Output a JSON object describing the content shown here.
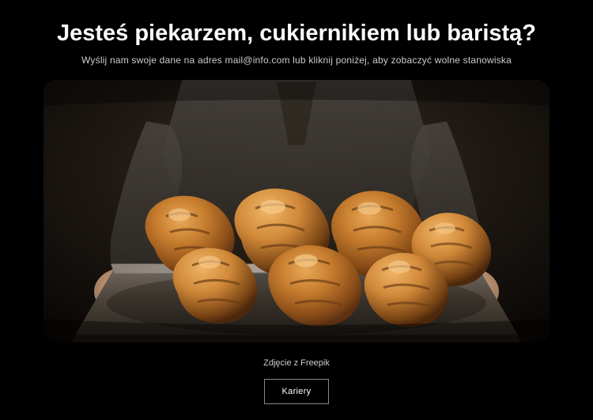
{
  "heading": "Jesteś piekarzem, cukiernikiem lub baristą?",
  "subheading": "Wyślij nam swoje dane na adres mail@info.com lub kliknij poniżej, aby zobaczyć wolne stanowiska",
  "caption": "Zdjęcie z Freepik",
  "cta_label": "Kariery"
}
